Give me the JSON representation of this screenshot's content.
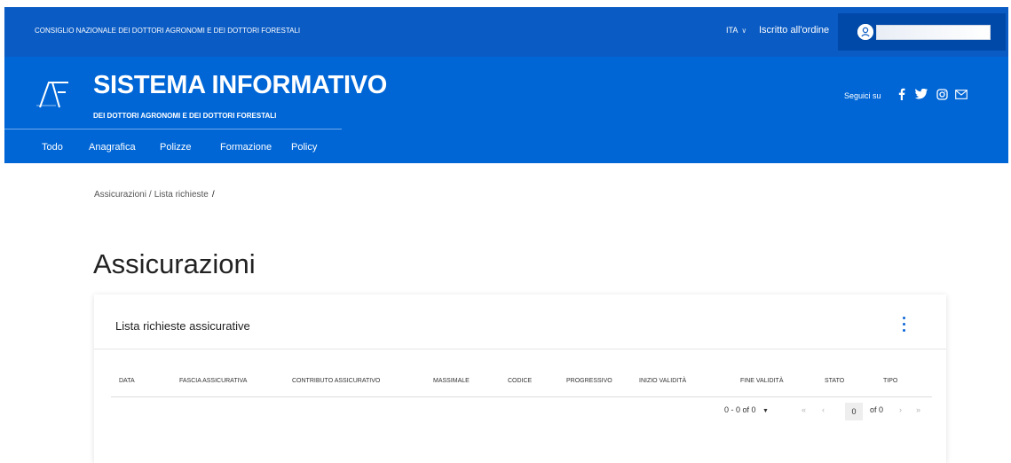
{
  "topbar": {
    "org_name": "CONSIGLIO NAZIONALE DEI DOTTORI AGRONOMI E DEI DOTTORI FORESTALI",
    "language": "ITA",
    "member_link": "Iscritto all'ordine",
    "user_name": ""
  },
  "header": {
    "title": "SISTEMA INFORMATIVO",
    "subtitle": "DEI DOTTORI AGRONOMI E DEI DOTTORI FORESTALI",
    "follow_label": "Seguici su",
    "social": [
      "facebook-icon",
      "twitter-icon",
      "instagram-icon",
      "email-icon"
    ]
  },
  "nav": {
    "items": [
      "Todo",
      "Anagrafica",
      "Polizze",
      "Formazione",
      "Policy"
    ]
  },
  "breadcrumb": {
    "items": [
      "Assicurazioni",
      "Lista richieste"
    ],
    "trailing_separator": "/"
  },
  "page": {
    "title": "Assicurazioni"
  },
  "card": {
    "title": "Lista richieste assicurative",
    "columns": [
      "DATA",
      "FASCIA ASSICURATIVA",
      "CONTRIBUTO ASSICURATIVO",
      "MASSIMALE",
      "CODICE",
      "PROGRESSIVO",
      "INIZIO VALIDITÀ",
      "FINE VALIDITÀ",
      "STATO",
      "TIPO"
    ],
    "rows": []
  },
  "pagination": {
    "range": "0 - 0 of 0",
    "first": "«",
    "prev": "‹",
    "current_page": "0",
    "of_pages": "of 0",
    "next": "›",
    "last": "»"
  },
  "colors": {
    "topbar": "#0a5bc4",
    "header": "#0066d6",
    "accent": "#0a66d6"
  }
}
